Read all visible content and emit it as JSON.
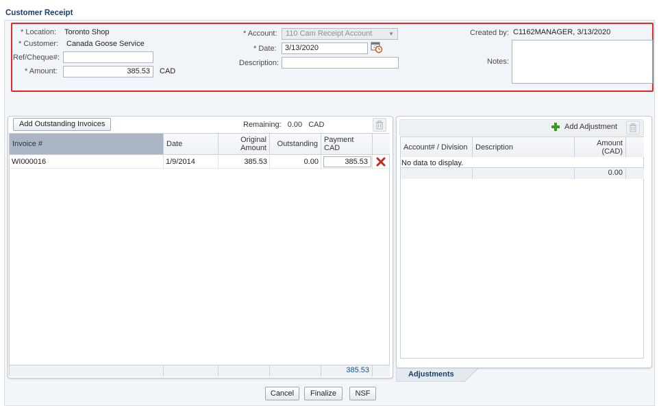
{
  "page": {
    "title": "Customer Receipt"
  },
  "header": {
    "location_label": "Location:",
    "location_value": "Toronto Shop",
    "customer_label": "Customer:",
    "customer_value": "Canada Goose Service",
    "ref_label": "Ref/Cheque#:",
    "ref_value": "",
    "amount_label": "Amount:",
    "amount_value": "385.53",
    "amount_currency": "CAD",
    "account_label": "Account:",
    "account_value": "110 Cam Receipt Account",
    "date_label": "Date:",
    "date_value": "3/13/2020",
    "description_label": "Description:",
    "description_value": "",
    "created_by_label": "Created by:",
    "created_by_value": "C1162MANAGER, 3/13/2020",
    "notes_label": "Notes:",
    "notes_value": "",
    "required_marker": "*"
  },
  "invoices": {
    "add_button": "Add Outstanding Invoices",
    "remaining_label": "Remaining:",
    "remaining_value": "0.00",
    "remaining_currency": "CAD",
    "columns": [
      "Invoice #",
      "Date",
      "Original Amount",
      "Outstanding",
      "Payment CAD"
    ],
    "rows": [
      {
        "invoice": "WI000016",
        "date": "1/9/2014",
        "original": "385.53",
        "outstanding": "0.00",
        "payment": "385.53"
      }
    ],
    "total_payment": "385.53"
  },
  "adjustments": {
    "add_button": "Add Adjustment",
    "columns": [
      "Account# / Division",
      "Description",
      "Amount (CAD)"
    ],
    "empty_text": "No data to display.",
    "total": "0.00",
    "tab_label": "Adjustments"
  },
  "actions": {
    "cancel": "Cancel",
    "finalize": "Finalize",
    "nsf": "NSF"
  },
  "icons": [
    "calendar-clock-icon",
    "delete-x-icon",
    "trash-icon",
    "add-plus-icon",
    "dropdown-arrow-icon"
  ],
  "colors": {
    "highlight_border": "#e4262b",
    "title": "#1a3f6b",
    "selected_header": "#aab6c5",
    "delete_red": "#d0231b",
    "add_green": "#3a9a1e"
  }
}
